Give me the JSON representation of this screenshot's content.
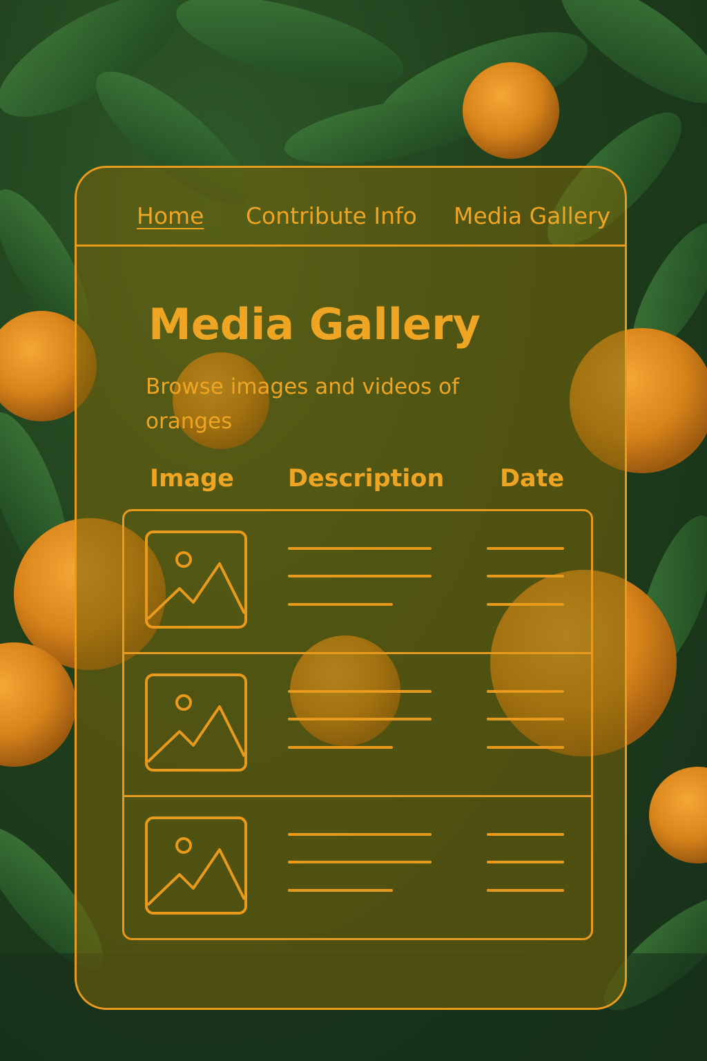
{
  "nav": {
    "items": [
      {
        "label": "Home",
        "active": true
      },
      {
        "label": "Contribute Info",
        "active": false
      },
      {
        "label": "Media Gallery",
        "active": false
      }
    ]
  },
  "page": {
    "title": "Media Gallery",
    "subtitle": "Browse images and videos of oranges"
  },
  "table": {
    "headers": [
      "Image",
      "Description",
      "Date"
    ],
    "rows": [
      {
        "thumbnail_icon": "image-placeholder-icon"
      },
      {
        "thumbnail_icon": "image-placeholder-icon"
      },
      {
        "thumbnail_icon": "image-placeholder-icon"
      }
    ]
  },
  "colors": {
    "accent": "#e79a1c",
    "panel_tint": "#78640a",
    "foliage": "#2f5a2a",
    "fruit": "#e08a1e"
  }
}
